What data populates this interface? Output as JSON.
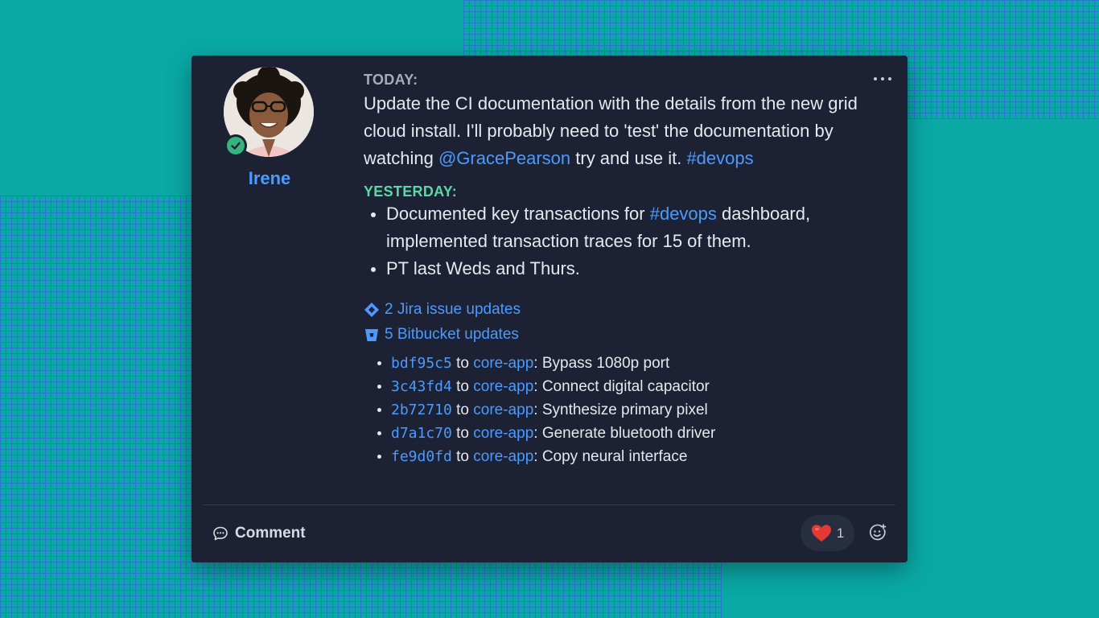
{
  "post": {
    "author": "Irene",
    "today_label": "TODAY:",
    "today_text_1": "Update the CI documentation with the details from the new grid cloud install. I'll probably need to 'test' the documentation by watching ",
    "today_mention": "@GracePearson",
    "today_text_2": " try and use it. ",
    "today_tag": "#devops",
    "yesterday_label": "YESTERDAY:",
    "yesterday_items": [
      {
        "pre": "Documented key transactions for ",
        "tag": "#devops",
        "post": " dashboard, implemented transaction traces for 15 of them."
      },
      {
        "pre": "PT last Weds and Thurs.",
        "tag": "",
        "post": ""
      }
    ]
  },
  "integrations": {
    "jira_label": "2 Jira issue updates",
    "bitbucket_label": "5 Bitbucket updates",
    "commits": [
      {
        "hash": "bdf95c5",
        "to": " to ",
        "repo": "core-app",
        "message": ": Bypass 1080p port"
      },
      {
        "hash": "3c43fd4",
        "to": " to ",
        "repo": "core-app",
        "message": ": Connect digital capacitor"
      },
      {
        "hash": "2b72710",
        "to": " to ",
        "repo": "core-app",
        "message": ": Synthesize primary pixel"
      },
      {
        "hash": "d7a1c70",
        "to": " to ",
        "repo": "core-app",
        "message": ": Generate bluetooth driver"
      },
      {
        "hash": "fe9d0fd",
        "to": " to ",
        "repo": "core-app",
        "message": ": Copy neural interface"
      }
    ]
  },
  "footer": {
    "comment_label": "Comment",
    "reaction_count": "1"
  },
  "colors": {
    "background": "#0aa9a6",
    "card": "#1c2233",
    "link": "#4c9aff",
    "today_label": "#a5adba",
    "yesterday_label": "#57d9a3",
    "online_badge": "#36b37e",
    "heart": "#e53935"
  },
  "icons": {
    "more": "more-horizontal-icon",
    "online": "check-circle-icon",
    "jira": "jira-icon",
    "bitbucket": "bitbucket-icon",
    "comment": "comment-bubble-icon",
    "heart": "heart-icon",
    "add_reaction": "add-emoji-icon"
  }
}
